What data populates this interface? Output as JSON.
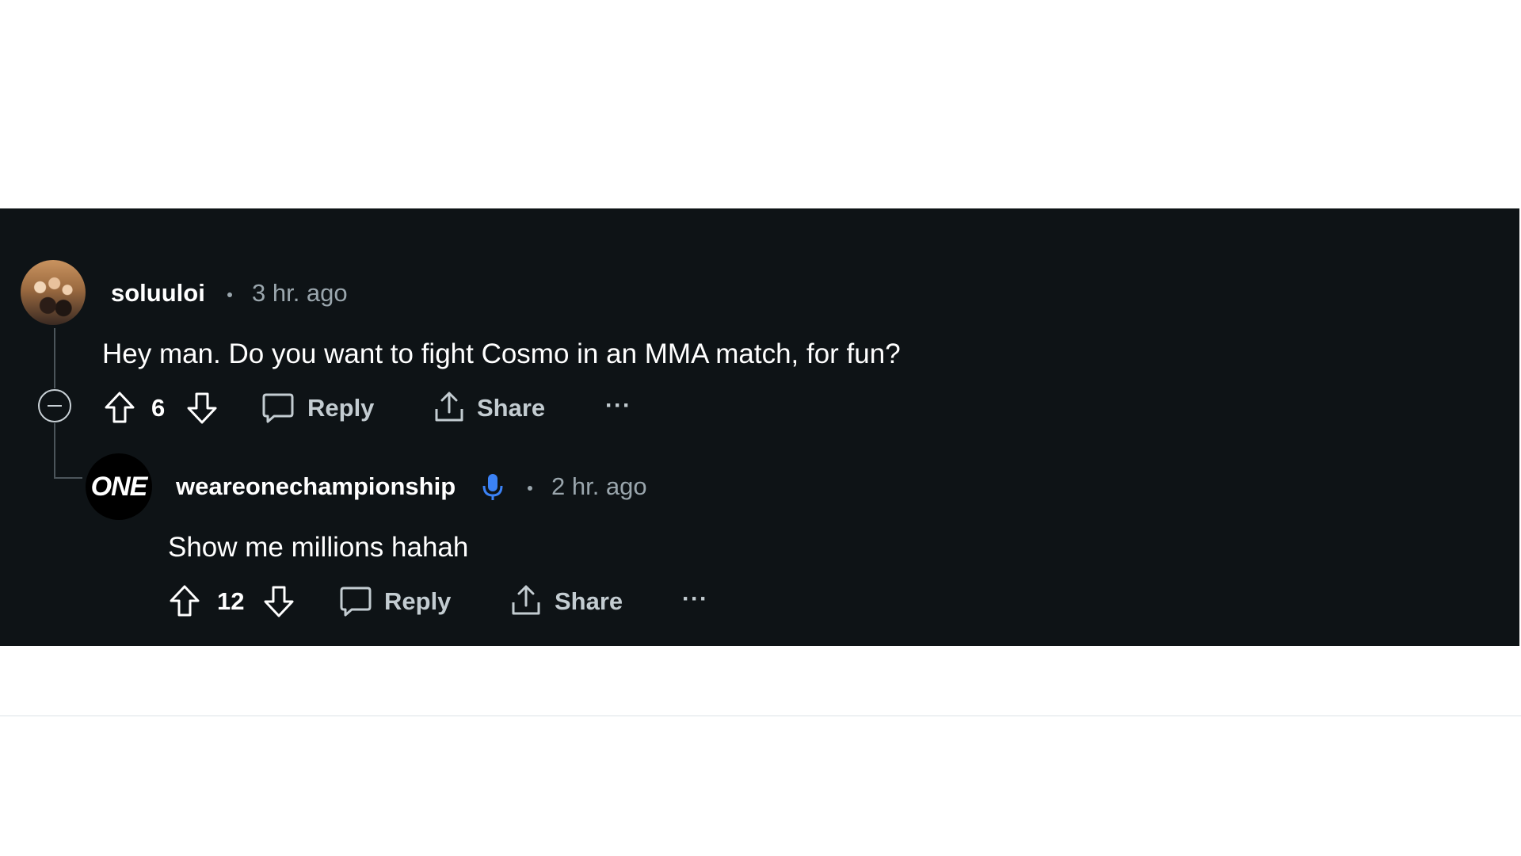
{
  "comments": [
    {
      "username": "soluuloi",
      "separator": "•",
      "time": "3 hr. ago",
      "body": "Hey man. Do you want to fight Cosmo in an MMA match, for fun?",
      "votes": "6",
      "reply_label": "Reply",
      "share_label": "Share",
      "more_label": "···",
      "avatar_icon": "user-photo-avatar"
    },
    {
      "username": "weareonechampionship",
      "badge_icon": "microphone-icon",
      "separator": "•",
      "time": "2 hr. ago",
      "body": "Show me millions hahah",
      "votes": "12",
      "reply_label": "Reply",
      "share_label": "Share",
      "more_label": "···",
      "avatar_logo_text": "ONE"
    }
  ],
  "colors": {
    "background": "#0e1316",
    "page": "#ffffff",
    "text": "#ffffff",
    "muted": "#9aa6ad",
    "badge_blue": "#3b82f6"
  }
}
